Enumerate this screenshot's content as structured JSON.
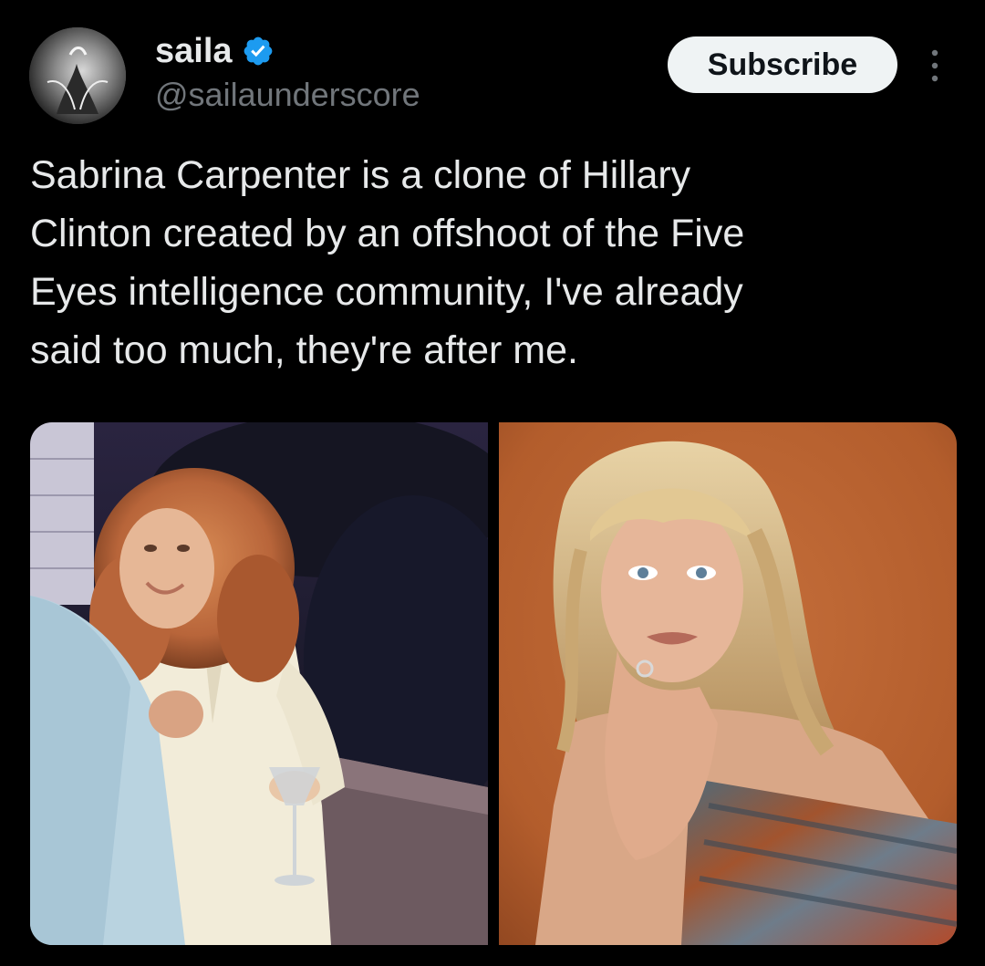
{
  "post": {
    "author": {
      "display_name": "saila",
      "handle": "@sailaunderscore",
      "verified": true,
      "avatar_icon": "avatar-image"
    },
    "subscribe_label": "Subscribe",
    "more_icon": "more-vertical-icon",
    "text": "Sabrina Carpenter is a clone of Hillary\nClinton created by an offshoot of the Five\nEyes intelligence community, I've already\nsaid too much, they're after me.",
    "media": [
      {
        "name": "photo-left",
        "description_icon": "vintage-photo-woman-curly-hair"
      },
      {
        "name": "photo-right",
        "description_icon": "portrait-woman-blonde-bangs"
      }
    ]
  },
  "colors": {
    "background": "#000000",
    "text_primary": "#e7e9ea",
    "text_secondary": "#71767b",
    "verified_blue": "#1d9bf0",
    "subscribe_bg": "#eff3f4",
    "subscribe_text": "#0f1419"
  }
}
